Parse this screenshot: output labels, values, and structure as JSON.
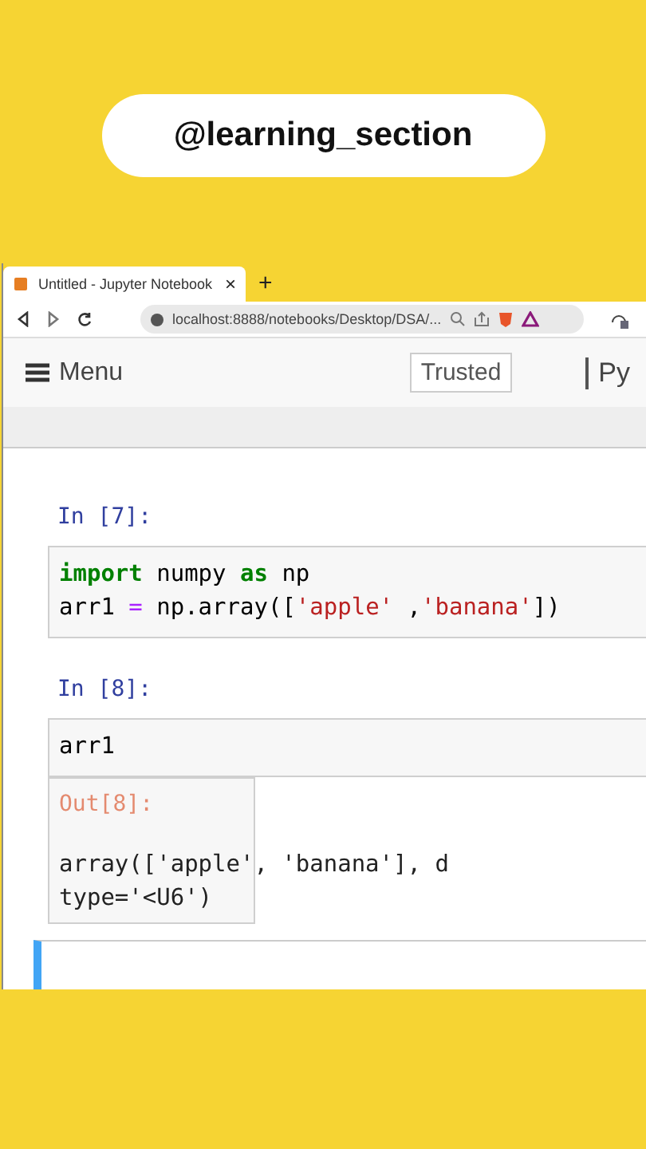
{
  "channel_badge": {
    "text": "@learning_section"
  },
  "browser": {
    "tab": {
      "title": "Untitled - Jupyter Notebook",
      "close": "×"
    },
    "new_tab": "+",
    "address": "localhost:8888/notebooks/Desktop/DSA/..."
  },
  "notebook": {
    "menu": "Menu",
    "trusted": "Trusted",
    "kernel": "Py",
    "cells": [
      {
        "prompt": "In [7]:",
        "selected": false,
        "lines": [
          [
            {
              "kind": "keyword",
              "text": "import"
            },
            {
              "kind": "plain",
              "text": " numpy "
            },
            {
              "kind": "keyword",
              "text": "as"
            },
            {
              "kind": "plain",
              "text": " np"
            }
          ],
          [
            {
              "kind": "plain",
              "text": "arr1 "
            },
            {
              "kind": "operator",
              "text": "="
            },
            {
              "kind": "plain",
              "text": " np.array(["
            },
            {
              "kind": "string",
              "text": "'apple'"
            },
            {
              "kind": "plain",
              "text": " ,"
            },
            {
              "kind": "string",
              "text": "'banana'"
            },
            {
              "kind": "plain",
              "text": "])"
            }
          ]
        ]
      },
      {
        "prompt": "In [8]:",
        "selected": false,
        "lines": [
          [
            {
              "kind": "plain",
              "text": "arr1"
            }
          ]
        ],
        "output": {
          "prompt": "Out[8]:",
          "lines": [
            "array(['apple', 'banana'], d",
            "type='<U6')"
          ]
        }
      },
      {
        "selected": true
      }
    ]
  }
}
